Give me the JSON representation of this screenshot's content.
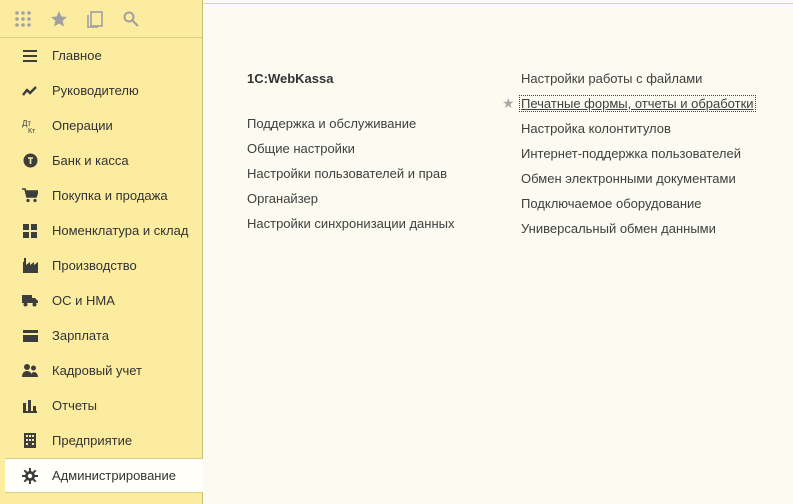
{
  "sidebar": {
    "items": [
      {
        "label": "Главное",
        "icon": "menu-lines-icon"
      },
      {
        "label": "Руководителю",
        "icon": "trend-icon"
      },
      {
        "label": "Операции",
        "icon": "dt-kt-icon"
      },
      {
        "label": "Банк и касса",
        "icon": "coin-icon"
      },
      {
        "label": "Покупка и продажа",
        "icon": "cart-icon"
      },
      {
        "label": "Номенклатура и склад",
        "icon": "grid-icon"
      },
      {
        "label": "Производство",
        "icon": "factory-icon"
      },
      {
        "label": "ОС и НМА",
        "icon": "truck-icon"
      },
      {
        "label": "Зарплата",
        "icon": "card-icon"
      },
      {
        "label": "Кадровый учет",
        "icon": "people-icon"
      },
      {
        "label": "Отчеты",
        "icon": "bar-chart-icon"
      },
      {
        "label": "Предприятие",
        "icon": "building-icon"
      },
      {
        "label": "Администрирование",
        "icon": "gear-icon"
      }
    ]
  },
  "content": {
    "col1": {
      "title": "1C:WebKassa",
      "links": [
        "Поддержка и обслуживание",
        "Общие настройки",
        "Настройки пользователей и прав",
        "Органайзер",
        "Настройки синхронизации данных"
      ]
    },
    "col2": {
      "links": [
        "Настройки работы с файлами",
        "Печатные формы, отчеты и обработки",
        "Настройка колонтитулов",
        "Интернет-поддержка пользователей",
        "Обмен электронными документами",
        "Подключаемое оборудование",
        "Универсальный обмен данными"
      ]
    }
  },
  "colors": {
    "sidebar_bg": "#fbeca0",
    "content_bg": "#fbfbf1",
    "active_item_bg": "#fffef8"
  }
}
